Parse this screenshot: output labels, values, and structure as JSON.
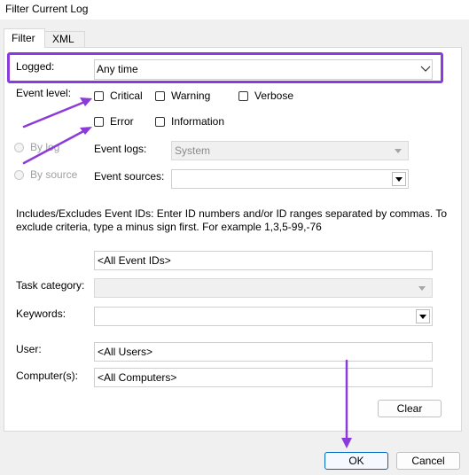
{
  "window": {
    "title": "Filter Current Log"
  },
  "tabs": [
    {
      "label": "Filter"
    },
    {
      "label": "XML"
    }
  ],
  "logged": {
    "label": "Logged:",
    "value": "Any time"
  },
  "event_level": {
    "label": "Event level:",
    "options": [
      {
        "label": "Critical",
        "checked": false
      },
      {
        "label": "Warning",
        "checked": false
      },
      {
        "label": "Verbose",
        "checked": false
      },
      {
        "label": "Error",
        "checked": false
      },
      {
        "label": "Information",
        "checked": false
      }
    ]
  },
  "scope": {
    "by_log": {
      "label": "By log",
      "enabled": false
    },
    "by_source": {
      "label": "By source",
      "enabled": false
    }
  },
  "event_logs": {
    "label": "Event logs:",
    "value": "System"
  },
  "event_sources": {
    "label": "Event sources:",
    "value": ""
  },
  "event_ids": {
    "description": "Includes/Excludes Event IDs: Enter ID numbers and/or ID ranges separated by commas. To exclude criteria, type a minus sign first. For example 1,3,5-99,-76",
    "value": "<All Event IDs>"
  },
  "task_category": {
    "label": "Task category:",
    "value": ""
  },
  "keywords": {
    "label": "Keywords:",
    "value": ""
  },
  "user": {
    "label": "User:",
    "value": "<All Users>"
  },
  "computer": {
    "label": "Computer(s):",
    "value": "<All Computers>"
  },
  "buttons": {
    "clear": "Clear",
    "ok": "OK",
    "cancel": "Cancel"
  },
  "annotation_color": "#8b3bd9"
}
